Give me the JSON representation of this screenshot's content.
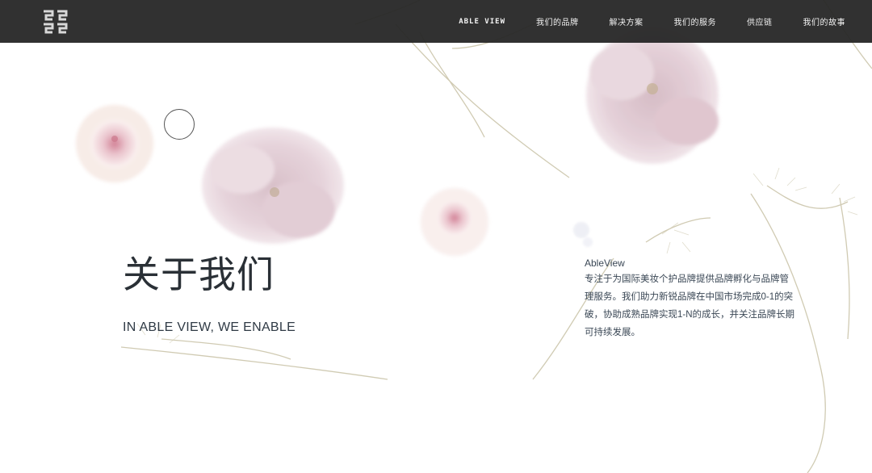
{
  "header": {
    "logo_name": "brand-logo",
    "nav": [
      {
        "label": "ABLE VIEW"
      },
      {
        "label": "我们的品牌"
      },
      {
        "label": "解决方案"
      },
      {
        "label": "我们的服务"
      },
      {
        "label": "供应链"
      },
      {
        "label": "我们的故事"
      }
    ]
  },
  "hero": {
    "title": "关于我们",
    "subtitle": "IN ABLE VIEW, WE ENABLE"
  },
  "about": {
    "heading": "AbleView",
    "text": "专注于为国际美妆个护品牌提供品牌孵化与品牌管理服务。我们助力新锐品牌在中国市场完成0-1的突破，协助成熟品牌实现1-N的成长，并关注品牌长期可持续发展。"
  },
  "colors": {
    "header_bg": "#262626",
    "title_text": "#2a3036",
    "body_text": "#3a4755",
    "flower_pink": "#d9b9c4",
    "flower_center": "#c46a83"
  }
}
